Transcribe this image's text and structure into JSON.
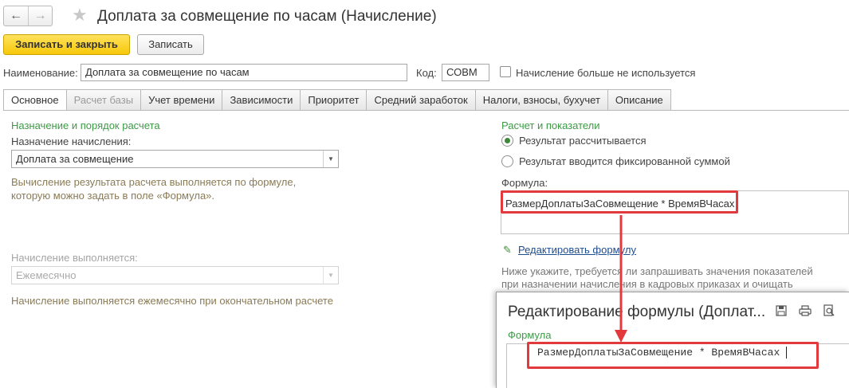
{
  "window": {
    "title": "Доплата за совмещение по часам (Начисление)"
  },
  "toolbar": {
    "save_close_label": "Записать и закрыть",
    "save_label": "Записать"
  },
  "header_fields": {
    "name_label": "Наименование:",
    "name_value": "Доплата за совмещение по часам",
    "code_label": "Код:",
    "code_value": "СОВМ",
    "unused_label": "Начисление больше не используется"
  },
  "tabs": [
    {
      "label": "Основное",
      "state": "active"
    },
    {
      "label": "Расчет базы",
      "state": "disabled"
    },
    {
      "label": "Учет времени",
      "state": "normal"
    },
    {
      "label": "Зависимости",
      "state": "normal"
    },
    {
      "label": "Приоритет",
      "state": "normal"
    },
    {
      "label": "Средний заработок",
      "state": "normal"
    },
    {
      "label": "Налоги, взносы, бухучет",
      "state": "normal"
    },
    {
      "label": "Описание",
      "state": "normal"
    }
  ],
  "left": {
    "section_title": "Назначение и порядок расчета",
    "purpose_label": "Назначение начисления:",
    "purpose_value": "Доплата за совмещение",
    "purpose_hint_line1": "Вычисление результата расчета выполняется по формуле,",
    "purpose_hint_line2": "которую можно задать в поле «Формула».",
    "performed_label": "Начисление выполняется:",
    "performed_value": "Ежемесячно",
    "performed_hint": "Начисление выполняется ежемесячно при окончательном расчете"
  },
  "right": {
    "section_title": "Расчет и показатели",
    "radio_calculated": "Результат рассчитывается",
    "radio_fixed": "Результат вводится фиксированной суммой",
    "formula_label": "Формула:",
    "formula_value": "РазмерДоплатыЗаСовмещение * ВремяВЧасах",
    "edit_formula_link": "Редактировать формулу",
    "indicators_hint_line1": "Ниже укажите, требуется ли запрашивать значения показателей",
    "indicators_hint_line2": "при назначении начисления в кадровых приказах и очищать"
  },
  "popup": {
    "title": "Редактирование формулы (Доплат...",
    "formula_section": "Формула",
    "formula_text": "РазмерДоплатыЗаСовмещение * ВремяВЧасах"
  },
  "icons": {
    "back": "arrow-left-icon",
    "forward": "arrow-right-icon",
    "favorite": "star-icon",
    "dropdown": "dropdown-triangle-icon",
    "edit": "pencil-icon",
    "save": "floppy-disk-icon",
    "print": "printer-icon",
    "preview": "print-preview-icon"
  },
  "colors": {
    "accent_green": "#3c9b45",
    "primary_button": "#f7c80a",
    "highlight_red": "#e2393c",
    "link_blue": "#1f4e8f"
  }
}
